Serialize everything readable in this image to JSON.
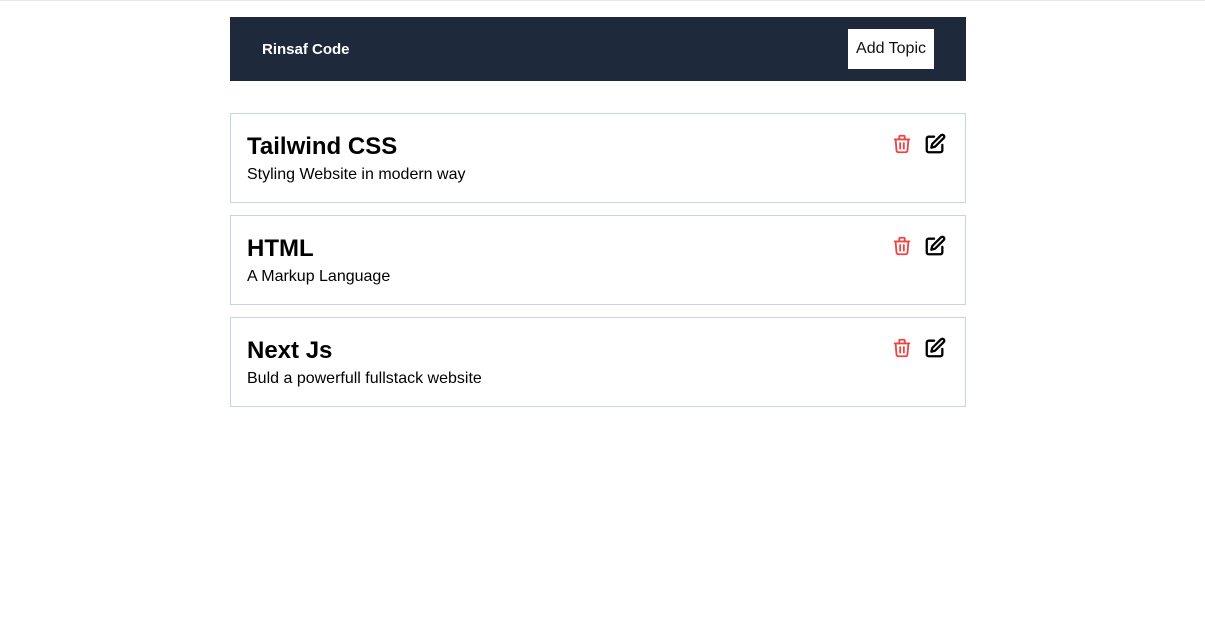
{
  "navbar": {
    "brand": "Rinsaf Code",
    "add_button": "Add Topic"
  },
  "topics": [
    {
      "title": "Tailwind CSS",
      "description": "Styling Website in modern way"
    },
    {
      "title": "HTML",
      "description": "A Markup Language"
    },
    {
      "title": "Next Js",
      "description": "Buld a powerfull fullstack website"
    }
  ],
  "icons": {
    "delete": "trash-icon",
    "edit": "edit-icon"
  },
  "colors": {
    "navbar_bg": "#1e293b",
    "delete_icon": "#ef4444",
    "card_border": "#cbd5e1"
  }
}
